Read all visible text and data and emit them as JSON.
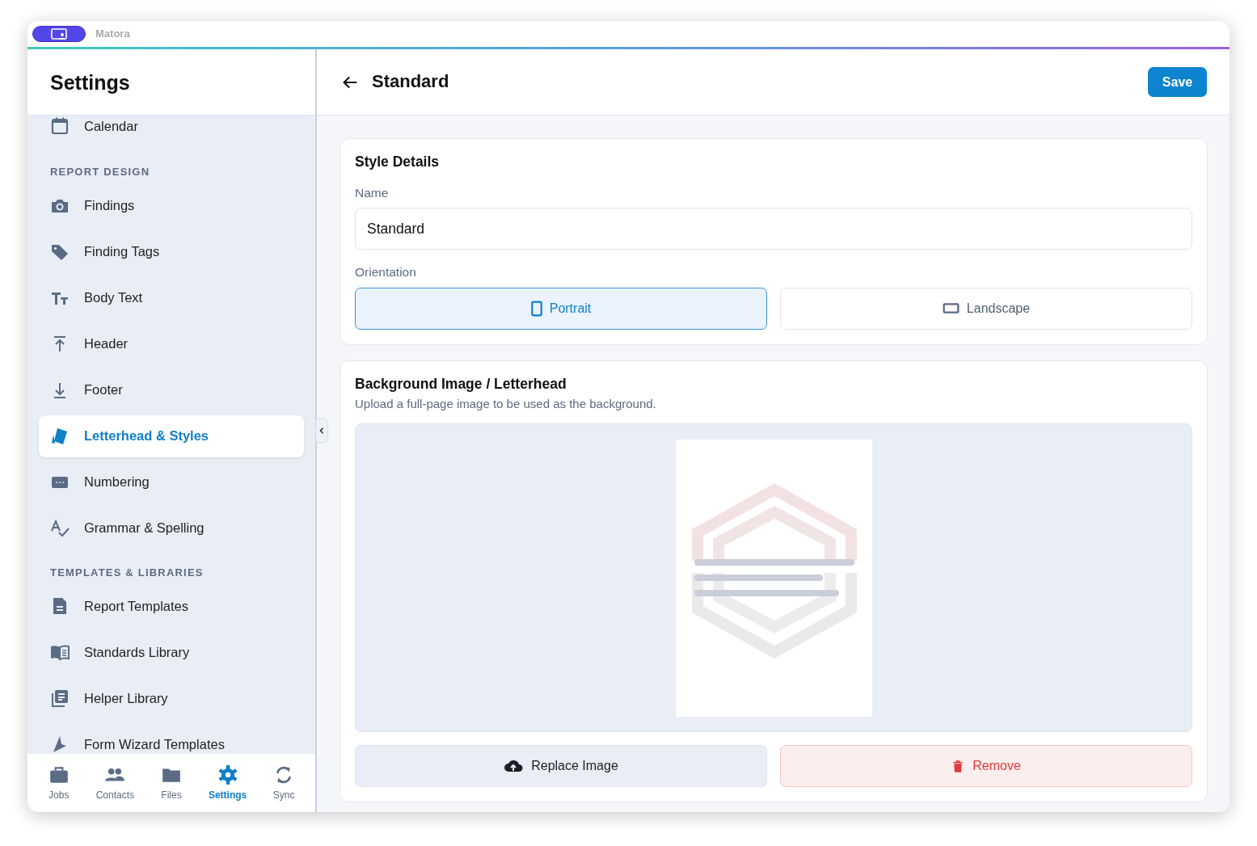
{
  "window": {
    "title": "Matora"
  },
  "sidebar": {
    "title": "Settings",
    "sections": [
      {
        "items": [
          {
            "label": "Calendar",
            "selected": false
          }
        ]
      },
      {
        "heading": "REPORT DESIGN",
        "items": [
          {
            "label": "Findings",
            "selected": false
          },
          {
            "label": "Finding Tags",
            "selected": false
          },
          {
            "label": "Body Text",
            "selected": false
          },
          {
            "label": "Header",
            "selected": false
          },
          {
            "label": "Footer",
            "selected": false
          },
          {
            "label": "Letterhead & Styles",
            "selected": true
          },
          {
            "label": "Numbering",
            "selected": false
          },
          {
            "label": "Grammar & Spelling",
            "selected": false
          }
        ]
      },
      {
        "heading": "TEMPLATES & LIBRARIES",
        "items": [
          {
            "label": "Report Templates",
            "selected": false
          },
          {
            "label": "Standards Library",
            "selected": false
          },
          {
            "label": "Helper Library",
            "selected": false
          },
          {
            "label": "Form Wizard Templates",
            "selected": false
          }
        ]
      }
    ]
  },
  "tab_bar": [
    {
      "label": "Jobs",
      "selected": false
    },
    {
      "label": "Contacts",
      "selected": false
    },
    {
      "label": "Files",
      "selected": false
    },
    {
      "label": "Settings",
      "selected": true
    },
    {
      "label": "Sync",
      "selected": false
    }
  ],
  "page": {
    "title": "Standard",
    "save_button": "Save"
  },
  "style_details": {
    "title": "Style Details",
    "name_label": "Name",
    "name_value": "Standard",
    "orientation_label": "Orientation",
    "orientations": [
      {
        "label": "Portrait",
        "kind": "portrait",
        "selected": true
      },
      {
        "label": "Landscape",
        "kind": "landscape",
        "selected": false
      }
    ]
  },
  "background": {
    "title": "Background Image / Letterhead",
    "description": "Upload a full-page image to be used as the background.",
    "buttons": [
      {
        "label": "Replace Image",
        "kind": "replace"
      },
      {
        "label": "Remove",
        "kind": "remove"
      }
    ]
  }
}
